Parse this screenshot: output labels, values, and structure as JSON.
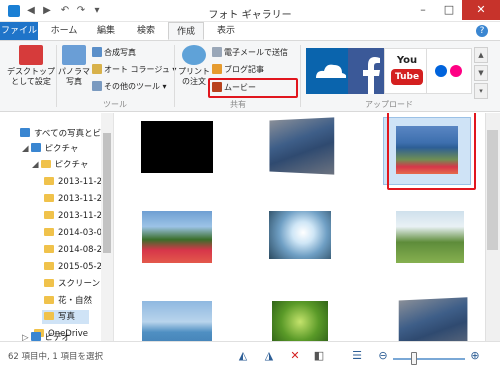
{
  "window": {
    "title": "フォト ギャラリー",
    "controls": {
      "minimize": "–",
      "maximize": "□",
      "close": "✕"
    }
  },
  "tabs": [
    {
      "label": "ファイル",
      "active": false
    },
    {
      "label": "ホーム",
      "active": false
    },
    {
      "label": "編集",
      "active": false
    },
    {
      "label": "検索",
      "active": false
    },
    {
      "label": "作成",
      "active": true
    },
    {
      "label": "表示",
      "active": false
    }
  ],
  "ribbon": {
    "desktop_button": "デスクトップ\nとして設定",
    "panorama_button": "パノラマ\n写真",
    "composite_photo": "合成写真",
    "auto_collage": "オート コラージュ ▾",
    "other_tools": "その他のツール ▾",
    "tools_group": "ツール",
    "print_order": "プリント\nの注文",
    "email": "電子メールで送信",
    "blog": "ブログ記事",
    "movie": "ムービー",
    "share_group": "共有",
    "upload_group": "アップロード",
    "upload_services": [
      {
        "name": "onedrive-icon",
        "color": "#0a64ad"
      },
      {
        "name": "facebook-icon",
        "color": "#3b5998"
      },
      {
        "name": "youtube-icon",
        "color": "#ffffff",
        "text": "You\nTube"
      },
      {
        "name": "flickr-icon",
        "color": "#ffffff"
      }
    ]
  },
  "nav": {
    "items": [
      {
        "label": "すべての写真とビデ",
        "level": 0
      },
      {
        "label": "ピクチャ",
        "level": 1
      },
      {
        "label": "ピクチャ",
        "level": 2
      },
      {
        "label": "2013-11-2",
        "level": 3
      },
      {
        "label": "2013-11-2",
        "level": 3
      },
      {
        "label": "2013-11-2",
        "level": 3
      },
      {
        "label": "2014-03-0",
        "level": 3
      },
      {
        "label": "2014-08-2",
        "level": 3
      },
      {
        "label": "2015-05-2",
        "level": 3
      },
      {
        "label": "スクリーンショ",
        "level": 3
      },
      {
        "label": "花・自然",
        "level": 3
      },
      {
        "label": "写真",
        "level": 3,
        "selected": true
      },
      {
        "label": "OneDrive",
        "level": 2
      },
      {
        "label": "ビデオ",
        "level": 1
      }
    ]
  },
  "status": {
    "text": "62 項目中, 1 項目を選択"
  },
  "zoom_level": 0.25,
  "colors": {
    "accent": "#1f74c9",
    "highlight": "#e1161e"
  }
}
